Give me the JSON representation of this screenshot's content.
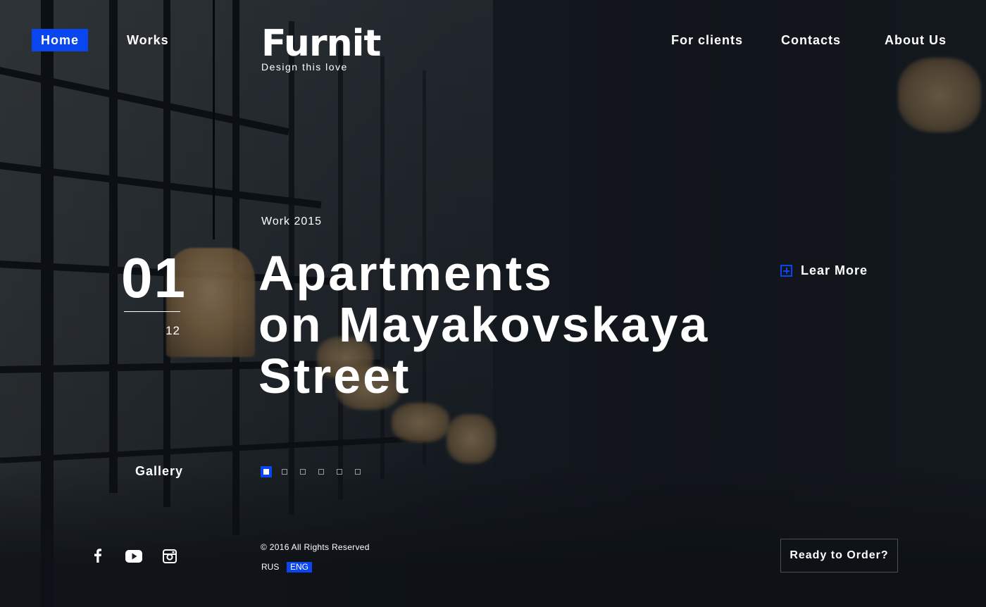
{
  "header": {
    "nav_left": [
      {
        "label": "Home",
        "active": true
      },
      {
        "label": "Works",
        "active": false
      }
    ],
    "logo": {
      "wordmark": "Furnit",
      "tagline": "Design this love"
    },
    "nav_right": [
      {
        "label": "For clients"
      },
      {
        "label": "Contacts"
      },
      {
        "label": "About Us"
      }
    ]
  },
  "slide": {
    "counter": {
      "current": "01",
      "total": "12"
    },
    "eyebrow": "Work 2015",
    "headline_lines": [
      "Apartments",
      "on Mayakovskaya",
      "Street"
    ],
    "learn_more_label": "Lear More",
    "gallery_label": "Gallery",
    "pager": {
      "count": 6,
      "active_index": 0
    }
  },
  "footer": {
    "social_icons": [
      "facebook-icon",
      "youtube-icon",
      "instagram-icon"
    ],
    "copyright": "© 2016 All Rights Reserved",
    "languages": [
      {
        "label": "RUS",
        "active": false
      },
      {
        "label": "ENG",
        "active": true
      }
    ],
    "order_button_label": "Ready to Order?"
  },
  "colors": {
    "accent": "#0a46f0",
    "text": "#ffffff",
    "background": "#151a1f"
  }
}
